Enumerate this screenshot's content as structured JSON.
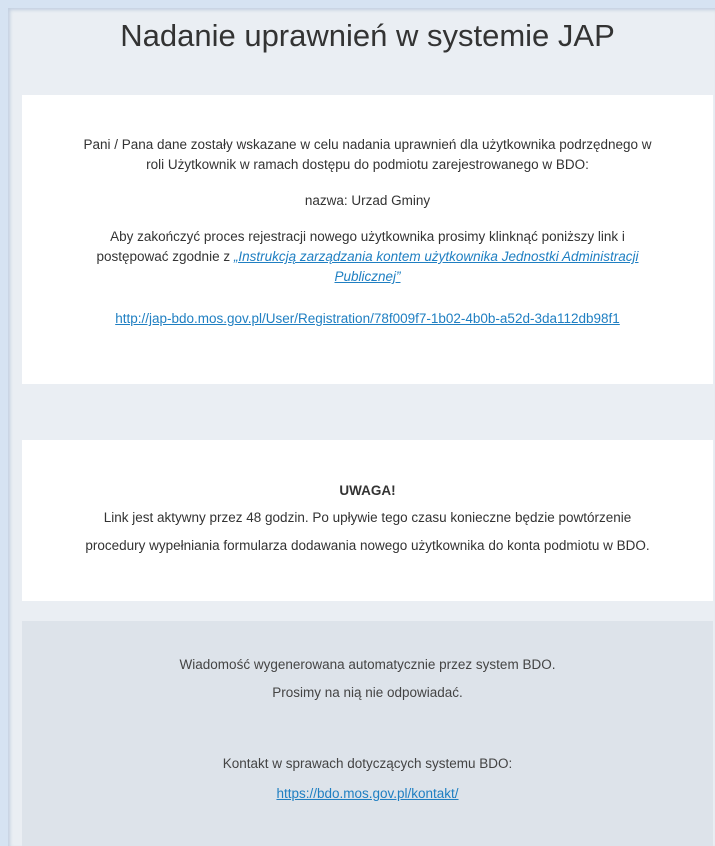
{
  "title": "Nadanie uprawnień w systemie JAP",
  "card1": {
    "intro_line1": "Pani / Pana dane zostały wskazane w celu nadania uprawnień dla użytkownika podrzędnego w",
    "intro_line2": "roli Użytkownik w ramach dostępu do podmiotu zarejestrowanego w BDO:",
    "name_line": "nazwa: Urzad Gminy",
    "instr_line1": "Aby zakończyć proces rejestracji nowego użytkownika prosimy klinknąć poniższy link i",
    "instr_line2_prefix": "postępować zgodnie z ",
    "instruction_link_part1": "„Instrukcją zarządzania kontem użytkownika Jednostki Administracji",
    "instruction_link_part2": "Publicznej”",
    "registration_link": "http://jap-bdo.mos.gov.pl/User/Registration/78f009f7-1b02-4b0b-a52d-3da112db98f1"
  },
  "card2": {
    "heading": "UWAGA!",
    "line1": "Link jest aktywny przez 48 godzin. Po upływie tego czasu konieczne będzie powtórzenie",
    "line2": "procedury wypełniania formularza dodawania nowego użytkownika do konta podmiotu w BDO."
  },
  "footer": {
    "auto_line": "Wiadomość wygenerowana automatycznie przez system BDO.",
    "no_reply_line": "Prosimy na nią nie odpowiadać.",
    "contact_line": "Kontakt w sprawach dotyczących systemu BDO:",
    "contact_link": "https://bdo.mos.gov.pl/kontakt/"
  },
  "colors": {
    "background": "#eaeef3",
    "card": "#ffffff",
    "footer": "#dde3ea",
    "link": "#1f7fc2",
    "text": "#333333"
  }
}
